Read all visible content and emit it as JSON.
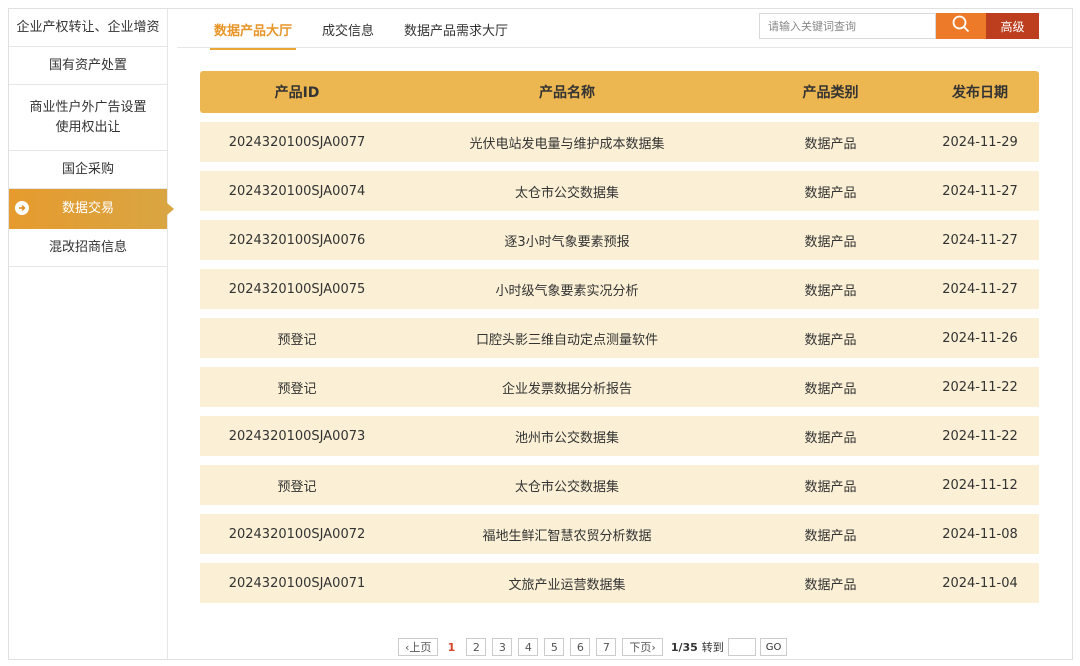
{
  "sidebar": {
    "items": [
      {
        "label": "企业产权转让、企业增资"
      },
      {
        "label": "国有资产处置"
      },
      {
        "label_line1": "商业性户外广告设置",
        "label_line2": "使用权出让"
      },
      {
        "label": "国企采购"
      },
      {
        "label": "数据交易"
      },
      {
        "label": "混改招商信息"
      }
    ]
  },
  "tabs": [
    "数据产品大厅",
    "成交信息",
    "数据产品需求大厅"
  ],
  "search": {
    "placeholder": "请输入关键词查询",
    "advanced_label": "高级"
  },
  "table": {
    "headers": [
      "产品ID",
      "产品名称",
      "产品类别",
      "发布日期"
    ],
    "rows": [
      [
        "2024320100SJA0077",
        "光伏电站发电量与维护成本数据集",
        "数据产品",
        "2024-11-29"
      ],
      [
        "2024320100SJA0074",
        "太仓市公交数据集",
        "数据产品",
        "2024-11-27"
      ],
      [
        "2024320100SJA0076",
        "逐3小时气象要素预报",
        "数据产品",
        "2024-11-27"
      ],
      [
        "2024320100SJA0075",
        "小时级气象要素实况分析",
        "数据产品",
        "2024-11-27"
      ],
      [
        "预登记",
        "口腔头影三维自动定点测量软件",
        "数据产品",
        "2024-11-26"
      ],
      [
        "预登记",
        "企业发票数据分析报告",
        "数据产品",
        "2024-11-22"
      ],
      [
        "2024320100SJA0073",
        "池州市公交数据集",
        "数据产品",
        "2024-11-22"
      ],
      [
        "预登记",
        "太仓市公交数据集",
        "数据产品",
        "2024-11-12"
      ],
      [
        "2024320100SJA0072",
        "福地生鲜汇智慧农贸分析数据",
        "数据产品",
        "2024-11-08"
      ],
      [
        "2024320100SJA0071",
        "文旅产业运营数据集",
        "数据产品",
        "2024-11-04"
      ]
    ]
  },
  "pager": {
    "prev": "‹上页",
    "pages": [
      "1",
      "2",
      "3",
      "4",
      "5",
      "6",
      "7"
    ],
    "next": "下页›",
    "info": "1/35",
    "goto": "转到",
    "go": "GO"
  },
  "colors": {
    "accent": "#e8962a",
    "header": "#ecb650",
    "row": "#fbf0d6",
    "search_btn": "#ec7a28",
    "advanced_btn": "#bc3e1f"
  }
}
